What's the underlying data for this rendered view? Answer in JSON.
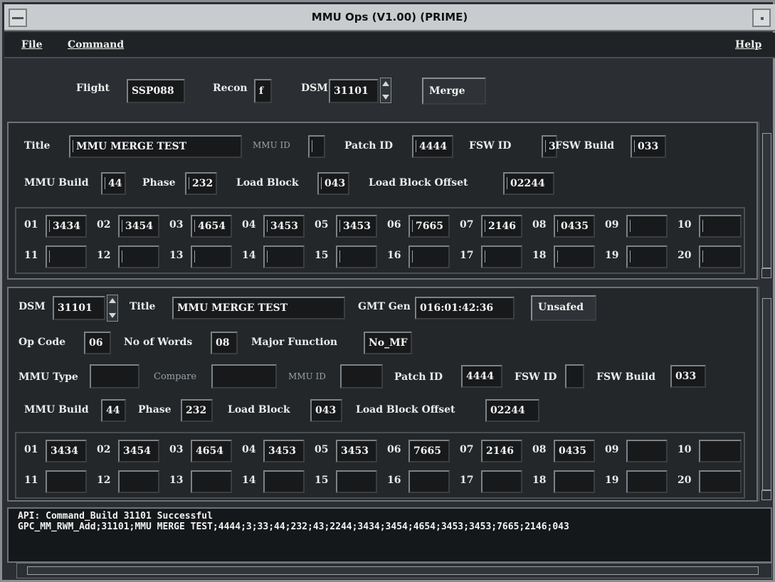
{
  "window": {
    "title": "MMU Ops (V1.00) (PRIME)"
  },
  "menu": {
    "file": "File",
    "command": "Command",
    "help": "Help"
  },
  "top": {
    "flight_label": "Flight",
    "flight_value": "SSP088",
    "recon_label": "Recon",
    "recon_value": "f",
    "dsm_label": "DSM",
    "dsm_value": "31101",
    "merge_button": "Merge"
  },
  "panel1": {
    "title_label": "Title",
    "title_value": "MMU MERGE TEST",
    "mmu_id_label": "MMU ID",
    "mmu_id_value": "",
    "patch_id_label": "Patch ID",
    "patch_id_value": "4444",
    "fsw_id_label": "FSW ID",
    "fsw_id_value": "3",
    "fsw_build_label": "FSW Build",
    "fsw_build_value": "033",
    "mmu_build_label": "MMU Build",
    "mmu_build_value": "44",
    "phase_label": "Phase",
    "phase_value": "232",
    "load_block_label": "Load Block",
    "load_block_value": "043",
    "lbo_label": "Load Block Offset",
    "lbo_value": "02244",
    "words": [
      {
        "n": "01",
        "v": "3434"
      },
      {
        "n": "02",
        "v": "3454"
      },
      {
        "n": "03",
        "v": "4654"
      },
      {
        "n": "04",
        "v": "3453"
      },
      {
        "n": "05",
        "v": "3453"
      },
      {
        "n": "06",
        "v": "7665"
      },
      {
        "n": "07",
        "v": "2146"
      },
      {
        "n": "08",
        "v": "0435"
      },
      {
        "n": "09",
        "v": ""
      },
      {
        "n": "10",
        "v": ""
      },
      {
        "n": "11",
        "v": ""
      },
      {
        "n": "12",
        "v": ""
      },
      {
        "n": "13",
        "v": ""
      },
      {
        "n": "14",
        "v": ""
      },
      {
        "n": "15",
        "v": ""
      },
      {
        "n": "16",
        "v": ""
      },
      {
        "n": "17",
        "v": ""
      },
      {
        "n": "18",
        "v": ""
      },
      {
        "n": "19",
        "v": ""
      },
      {
        "n": "20",
        "v": ""
      }
    ]
  },
  "panel2": {
    "dsm_label": "DSM",
    "dsm_value": "31101",
    "title_label": "Title",
    "title_value": "MMU MERGE TEST",
    "gmt_label": "GMT Gen",
    "gmt_value": "016:01:42:36",
    "unsafed_button": "Unsafed",
    "opcode_label": "Op Code",
    "opcode_value": "06",
    "nwords_label": "No of Words",
    "nwords_value": "08",
    "majfn_label": "Major Function",
    "majfn_value": "No_MF",
    "mmu_type_label": "MMU Type",
    "mmu_type_value": "",
    "compare_label": "Compare",
    "compare_value": "",
    "mmu_id_label": "MMU ID",
    "mmu_id_value": "",
    "patch_id_label": "Patch ID",
    "patch_id_value": "4444",
    "fsw_id_label": "FSW ID",
    "fsw_id_value": "",
    "fsw_build_label": "FSW Build",
    "fsw_build_value": "033",
    "mmu_build_label": "MMU Build",
    "mmu_build_value": "44",
    "phase_label": "Phase",
    "phase_value": "232",
    "load_block_label": "Load Block",
    "load_block_value": "043",
    "lbo_label": "Load Block Offset",
    "lbo_value": "02244",
    "words": [
      {
        "n": "01",
        "v": "3434"
      },
      {
        "n": "02",
        "v": "3454"
      },
      {
        "n": "03",
        "v": "4654"
      },
      {
        "n": "04",
        "v": "3453"
      },
      {
        "n": "05",
        "v": "3453"
      },
      {
        "n": "06",
        "v": "7665"
      },
      {
        "n": "07",
        "v": "2146"
      },
      {
        "n": "08",
        "v": "0435"
      },
      {
        "n": "09",
        "v": ""
      },
      {
        "n": "10",
        "v": ""
      },
      {
        "n": "11",
        "v": ""
      },
      {
        "n": "12",
        "v": ""
      },
      {
        "n": "13",
        "v": ""
      },
      {
        "n": "14",
        "v": ""
      },
      {
        "n": "15",
        "v": ""
      },
      {
        "n": "16",
        "v": ""
      },
      {
        "n": "17",
        "v": ""
      },
      {
        "n": "18",
        "v": ""
      },
      {
        "n": "19",
        "v": ""
      },
      {
        "n": "20",
        "v": ""
      }
    ]
  },
  "status": {
    "line1": "API: Command_Build 31101 Successful",
    "line2": "GPC_MM_RWM_Add;31101;MMU MERGE TEST;4444;3;33;44;232;43;2244;3434;3454;4654;3453;3453;7665;2146;043"
  }
}
